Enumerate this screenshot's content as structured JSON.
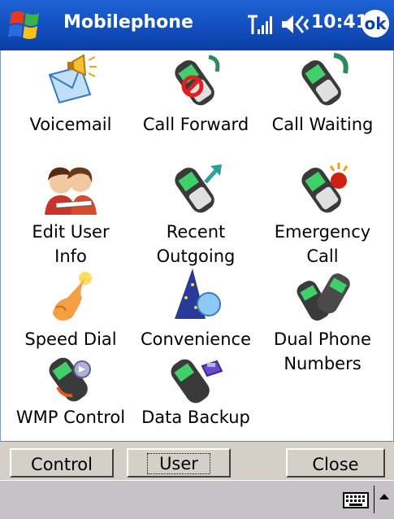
{
  "window": {
    "title": "Mobilephone",
    "time": "10:41",
    "ok_label": "ok"
  },
  "items": [
    {
      "label": "Voicemail",
      "icon": "voicemail-icon"
    },
    {
      "label": "Call Forward",
      "icon": "call-forward-icon"
    },
    {
      "label": "Call Waiting",
      "icon": "call-waiting-icon"
    },
    {
      "label": "Edit User\nInfo",
      "icon": "edit-user-info-icon"
    },
    {
      "label": "Recent\nOutgoing",
      "icon": "recent-outgoing-icon"
    },
    {
      "label": "Emergency\nCall",
      "icon": "emergency-call-icon"
    },
    {
      "label": "Speed Dial",
      "icon": "speed-dial-icon"
    },
    {
      "label": "Convenience",
      "icon": "convenience-icon"
    },
    {
      "label": "Dual Phone\nNumbers",
      "icon": "dual-phone-numbers-icon"
    },
    {
      "label": "WMP Control",
      "icon": "wmp-control-icon"
    },
    {
      "label": "Data Backup",
      "icon": "data-backup-icon"
    }
  ],
  "buttons": {
    "control": "Control",
    "user": "User",
    "close": "Close"
  },
  "colors": {
    "titlebar": "#0a3ea8",
    "button_face": "#d4d0c8"
  }
}
